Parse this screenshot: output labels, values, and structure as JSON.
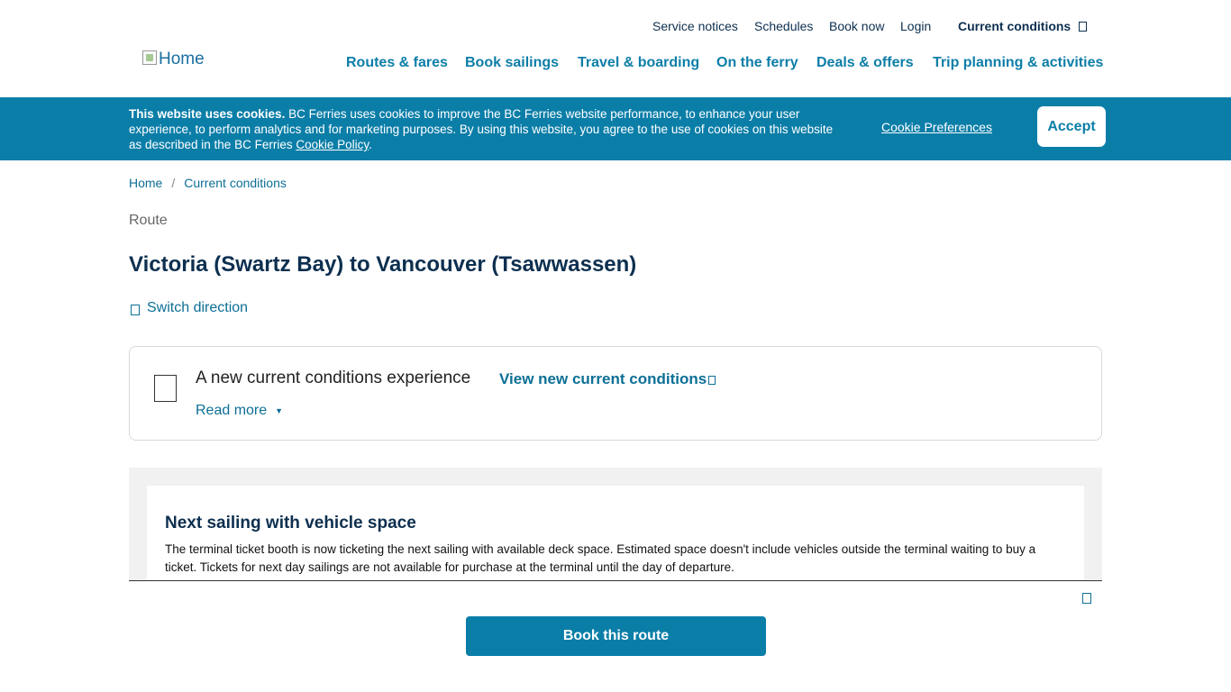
{
  "header": {
    "logo_alt": "Home",
    "utility_nav": [
      "Service notices",
      "Schedules",
      "Book now",
      "Login"
    ],
    "current_conditions": "Current conditions",
    "main_nav": [
      "Routes & fares",
      "Book sailings",
      "Travel & boarding",
      "On the ferry",
      "Deals & offers",
      "Trip planning & activities"
    ]
  },
  "cookie_banner": {
    "bold": "This website uses cookies.",
    "text": " BC Ferries uses cookies to improve the BC Ferries website performance, to enhance your user experience, to perform analytics and for marketing purposes. By using this website, you agree to the use of cookies on this website as described in the BC Ferries ",
    "policy_link": "Cookie Policy",
    "period": ".",
    "preferences": "Cookie Preferences",
    "accept": "Accept"
  },
  "breadcrumb": {
    "home": "Home",
    "separator": "/",
    "current": "Current conditions"
  },
  "route": {
    "label": "Route",
    "title": "Victoria (Swartz Bay) to Vancouver (Tsawwassen)",
    "switch": "Switch direction"
  },
  "notice": {
    "title": "A new current conditions experience",
    "link": "View new current conditions",
    "read_more": "Read more"
  },
  "next_sailing": {
    "title": "Next sailing with vehicle space",
    "description": "The terminal ticket booth is now ticketing the next sailing with available deck space. Estimated space doesn't include vehicles outside the terminal waiting to buy a ticket. Tickets for next day sailings are not available for purchase at the terminal until the day of departure."
  },
  "sticky": {
    "book_button": "Book this route"
  }
}
